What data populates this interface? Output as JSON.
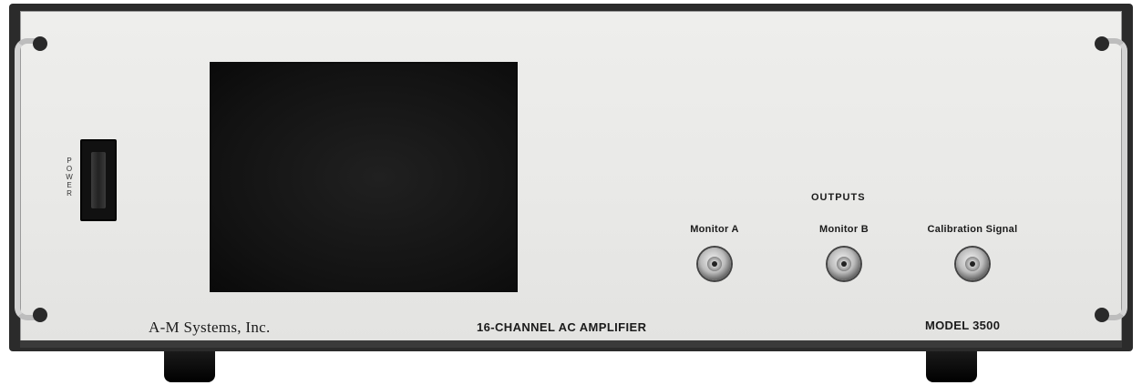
{
  "panel": {
    "power_label": "POWER",
    "outputs_heading": "OUTPUTS",
    "connectors": [
      {
        "label": "Monitor A"
      },
      {
        "label": "Monitor B"
      },
      {
        "label": "Calibration Signal"
      }
    ],
    "brand": "A-M Systems, Inc.",
    "product_name": "16-CHANNEL AC AMPLIFIER",
    "model": "MODEL 3500"
  }
}
